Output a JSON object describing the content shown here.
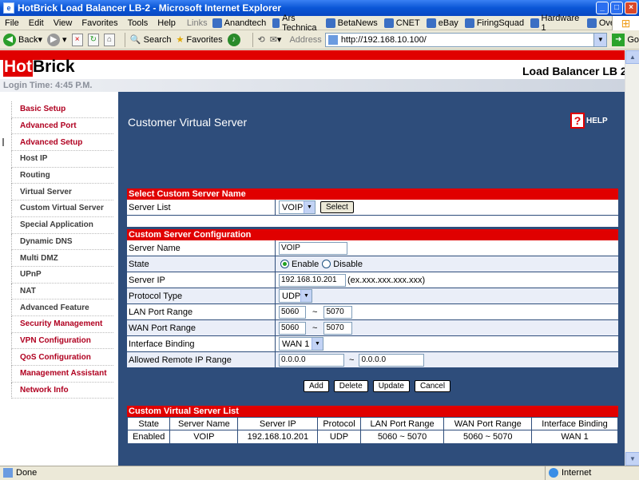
{
  "window": {
    "title": "HotBrick Load Balancer LB-2 - Microsoft Internet Explorer"
  },
  "menu": [
    "File",
    "Edit",
    "View",
    "Favorites",
    "Tools",
    "Help"
  ],
  "links": {
    "label": "Links",
    "items": [
      "Anandtech",
      "Ars Technica",
      "BetaNews",
      "CNET",
      "eBay",
      "FiringSquad",
      "Hardware 1",
      "Overclockers.com"
    ]
  },
  "toolbar": {
    "back": "Back",
    "search": "Search",
    "favorites": "Favorites",
    "address_label": "Address",
    "url": "http://192.168.10.100/",
    "go": "Go"
  },
  "status": {
    "text": "Done",
    "zone": "Internet"
  },
  "header": {
    "logo_hot": "Hot",
    "logo_brick": "Brick",
    "product": "Load Balancer LB 2",
    "login": "Login Time: 4:45 P.M."
  },
  "nav": [
    {
      "label": "Basic Setup",
      "type": "main"
    },
    {
      "label": "Advanced Port",
      "type": "main"
    },
    {
      "label": "Advanced Setup",
      "type": "main",
      "active": true
    },
    {
      "label": "Host IP",
      "type": "sub"
    },
    {
      "label": "Routing",
      "type": "sub"
    },
    {
      "label": "Virtual Server",
      "type": "sub"
    },
    {
      "label": "Custom Virtual Server",
      "type": "sub"
    },
    {
      "label": "Special Application",
      "type": "sub"
    },
    {
      "label": "Dynamic DNS",
      "type": "sub"
    },
    {
      "label": "Multi DMZ",
      "type": "sub"
    },
    {
      "label": "UPnP",
      "type": "sub"
    },
    {
      "label": "NAT",
      "type": "sub"
    },
    {
      "label": "Advanced Feature",
      "type": "sub"
    },
    {
      "label": "Security Management",
      "type": "main"
    },
    {
      "label": "VPN Configuration",
      "type": "main"
    },
    {
      "label": "QoS Configuration",
      "type": "main"
    },
    {
      "label": "Management Assistant",
      "type": "main"
    },
    {
      "label": "Network Info",
      "type": "main"
    }
  ],
  "content": {
    "title": "Customer Virtual Server",
    "help": "HELP",
    "select_section": {
      "header": "Select Custom Server Name",
      "label": "Server List",
      "value": "VOIP",
      "button": "Select"
    },
    "config_section": {
      "header": "Custom Server Configuration",
      "server_name_label": "Server Name",
      "server_name": "VOIP",
      "state_label": "State",
      "enable": "Enable",
      "disable": "Disable",
      "server_ip_label": "Server IP",
      "server_ip": "192.168.10.201",
      "server_ip_hint": "(ex.xxx.xxx.xxx.xxx)",
      "protocol_label": "Protocol Type",
      "protocol": "UDP",
      "lan_label": "LAN Port Range",
      "lan_from": "5060",
      "lan_to": "5070",
      "wan_label": "WAN Port Range",
      "wan_from": "5060",
      "wan_to": "5070",
      "binding_label": "Interface Binding",
      "binding": "WAN 1",
      "remote_label": "Allowed Remote IP Range",
      "remote_from": "0.0.0.0",
      "remote_to": "0.0.0.0",
      "tilde": "~"
    },
    "actions": {
      "add": "Add",
      "delete": "Delete",
      "update": "Update",
      "cancel": "Cancel"
    },
    "list": {
      "header": "Custom Virtual Server List",
      "columns": [
        "State",
        "Server Name",
        "Server IP",
        "Protocol",
        "LAN Port Range",
        "WAN Port Range",
        "Interface Binding"
      ],
      "rows": [
        [
          "Enabled",
          "VOIP",
          "192.168.10.201",
          "UDP",
          "5060 ~ 5070",
          "5060 ~ 5070",
          "WAN 1"
        ]
      ]
    }
  }
}
